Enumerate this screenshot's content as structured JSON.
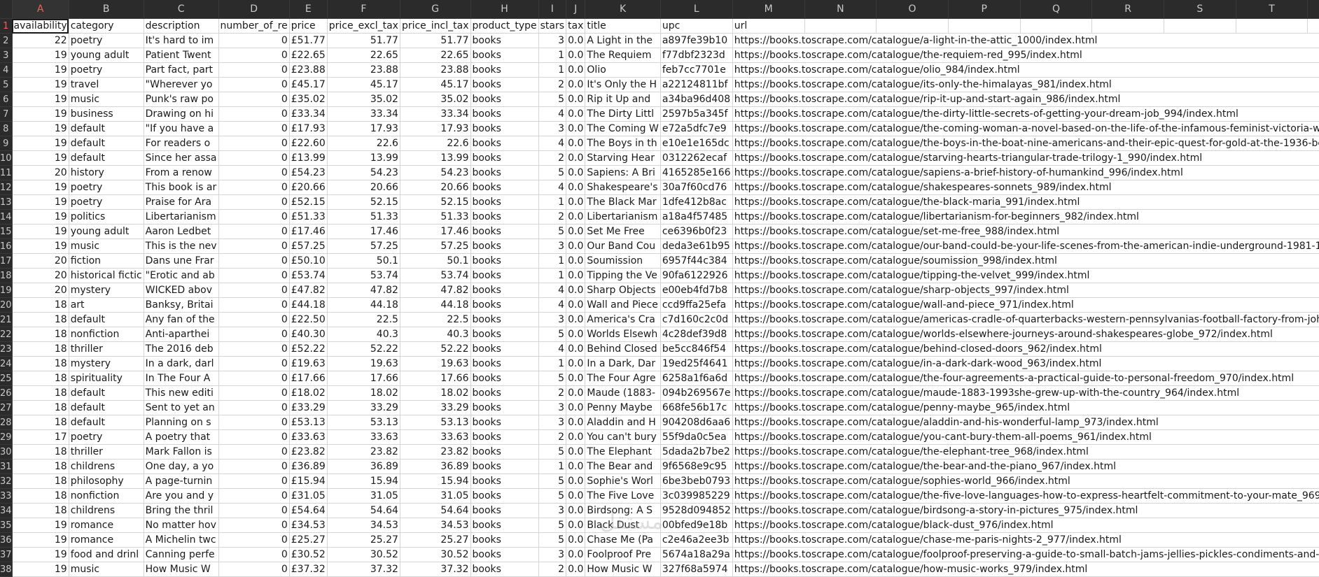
{
  "columns": [
    "A",
    "B",
    "C",
    "D",
    "E",
    "F",
    "G",
    "H",
    "I",
    "J",
    "K",
    "L",
    "M",
    "N",
    "O",
    "P",
    "Q",
    "R",
    "S",
    "T",
    ""
  ],
  "active_column": "A",
  "active_row": "1",
  "headers": [
    "availability",
    "category",
    "description",
    "number_of_re",
    "price",
    "price_excl_tax",
    "price_incl_tax",
    "product_type",
    "stars",
    "tax",
    "title",
    "upc",
    "url",
    "",
    "",
    "",
    "",
    "",
    "",
    "",
    ""
  ],
  "rows": [
    [
      "2",
      "22",
      "poetry",
      "It's hard to im",
      "0",
      "£51.77",
      "51.77",
      "51.77",
      "books",
      "3",
      "0.0",
      "A Light in the",
      "a897fe39b10",
      "https://books.toscrape.com/catalogue/a-light-in-the-attic_1000/index.html"
    ],
    [
      "3",
      "19",
      "young adult",
      "Patient Twent",
      "0",
      "£22.65",
      "22.65",
      "22.65",
      "books",
      "1",
      "0.0",
      "The Requiem",
      "f77dbf2323d",
      "https://books.toscrape.com/catalogue/the-requiem-red_995/index.html"
    ],
    [
      "4",
      "19",
      "poetry",
      "Part fact, part",
      "0",
      "£23.88",
      "23.88",
      "23.88",
      "books",
      "1",
      "0.0",
      "Olio",
      "feb7cc7701e",
      "https://books.toscrape.com/catalogue/olio_984/index.html"
    ],
    [
      "5",
      "19",
      "travel",
      "\"Wherever yo",
      "0",
      "£45.17",
      "45.17",
      "45.17",
      "books",
      "2",
      "0.0",
      "It's Only the H",
      "a22124811bf",
      "https://books.toscrape.com/catalogue/its-only-the-himalayas_981/index.html"
    ],
    [
      "6",
      "19",
      "music",
      "Punk's raw po",
      "0",
      "£35.02",
      "35.02",
      "35.02",
      "books",
      "5",
      "0.0",
      "Rip it Up and",
      "a34ba96d408",
      "https://books.toscrape.com/catalogue/rip-it-up-and-start-again_986/index.html"
    ],
    [
      "7",
      "19",
      "business",
      "Drawing on hi",
      "0",
      "£33.34",
      "33.34",
      "33.34",
      "books",
      "4",
      "0.0",
      "The Dirty Littl",
      "2597b5a345f",
      "https://books.toscrape.com/catalogue/the-dirty-little-secrets-of-getting-your-dream-job_994/index.html"
    ],
    [
      "8",
      "19",
      "default",
      "\"If you have a",
      "0",
      "£17.93",
      "17.93",
      "17.93",
      "books",
      "3",
      "0.0",
      "The Coming W",
      "e72a5dfc7e9",
      "https://books.toscrape.com/catalogue/the-coming-woman-a-novel-based-on-the-life-of-the-infamous-feminist-victoria-woo"
    ],
    [
      "9",
      "19",
      "default",
      "For readers o",
      "0",
      "£22.60",
      "22.6",
      "22.6",
      "books",
      "4",
      "0.0",
      "The Boys in th",
      "e10e1e165dc",
      "https://books.toscrape.com/catalogue/the-boys-in-the-boat-nine-americans-and-their-epic-quest-for-gold-at-the-1936-ber"
    ],
    [
      "10",
      "19",
      "default",
      "Since her assa",
      "0",
      "£13.99",
      "13.99",
      "13.99",
      "books",
      "2",
      "0.0",
      "Starving Hear",
      "0312262ecaf",
      "https://books.toscrape.com/catalogue/starving-hearts-triangular-trade-trilogy-1_990/index.html"
    ],
    [
      "11",
      "20",
      "history",
      "From a renow",
      "0",
      "£54.23",
      "54.23",
      "54.23",
      "books",
      "5",
      "0.0",
      "Sapiens: A Bri",
      "4165285e166",
      "https://books.toscrape.com/catalogue/sapiens-a-brief-history-of-humankind_996/index.html"
    ],
    [
      "12",
      "19",
      "poetry",
      "This book is ar",
      "0",
      "£20.66",
      "20.66",
      "20.66",
      "books",
      "4",
      "0.0",
      "Shakespeare's",
      "30a7f60cd76",
      "https://books.toscrape.com/catalogue/shakespeares-sonnets_989/index.html"
    ],
    [
      "13",
      "19",
      "poetry",
      "Praise for Ara",
      "0",
      "£52.15",
      "52.15",
      "52.15",
      "books",
      "1",
      "0.0",
      "The Black Mar",
      "1dfe412b8ac",
      "https://books.toscrape.com/catalogue/the-black-maria_991/index.html"
    ],
    [
      "14",
      "19",
      "politics",
      "Libertarianism",
      "0",
      "£51.33",
      "51.33",
      "51.33",
      "books",
      "2",
      "0.0",
      "Libertarianism",
      "a18a4f57485",
      "https://books.toscrape.com/catalogue/libertarianism-for-beginners_982/index.html"
    ],
    [
      "15",
      "19",
      "young adult",
      "Aaron Ledbet",
      "0",
      "£17.46",
      "17.46",
      "17.46",
      "books",
      "5",
      "0.0",
      "Set Me Free",
      "ce6396b0f23",
      "https://books.toscrape.com/catalogue/set-me-free_988/index.html"
    ],
    [
      "16",
      "19",
      "music",
      "This is the nev",
      "0",
      "£57.25",
      "57.25",
      "57.25",
      "books",
      "3",
      "0.0",
      "Our Band Cou",
      "deda3e61b95",
      "https://books.toscrape.com/catalogue/our-band-could-be-your-life-scenes-from-the-american-indie-underground-1981-19"
    ],
    [
      "17",
      "20",
      "fiction",
      "Dans une Frar",
      "0",
      "£50.10",
      "50.1",
      "50.1",
      "books",
      "1",
      "0.0",
      "Soumission",
      "6957f44c384",
      "https://books.toscrape.com/catalogue/soumission_998/index.html"
    ],
    [
      "18",
      "20",
      "historical fictic",
      "\"Erotic and ab",
      "0",
      "£53.74",
      "53.74",
      "53.74",
      "books",
      "1",
      "0.0",
      "Tipping the Ve",
      "90fa6122926",
      "https://books.toscrape.com/catalogue/tipping-the-velvet_999/index.html"
    ],
    [
      "19",
      "20",
      "mystery",
      "WICKED abov",
      "0",
      "£47.82",
      "47.82",
      "47.82",
      "books",
      "4",
      "0.0",
      "Sharp Objects",
      "e00eb4fd7b8",
      "https://books.toscrape.com/catalogue/sharp-objects_997/index.html"
    ],
    [
      "20",
      "18",
      "art",
      "Banksy, Britai",
      "0",
      "£44.18",
      "44.18",
      "44.18",
      "books",
      "4",
      "0.0",
      "Wall and Piece",
      "ccd9ffa25efa",
      "https://books.toscrape.com/catalogue/wall-and-piece_971/index.html"
    ],
    [
      "21",
      "18",
      "default",
      "Any fan of the",
      "0",
      "£22.50",
      "22.5",
      "22.5",
      "books",
      "3",
      "0.0",
      "America's Cra",
      "c7d160c2c0d",
      "https://books.toscrape.com/catalogue/americas-cradle-of-quarterbacks-western-pennsylvanias-football-factory-from-johnn"
    ],
    [
      "22",
      "18",
      "nonfiction",
      "Anti-aparthei",
      "0",
      "£40.30",
      "40.3",
      "40.3",
      "books",
      "5",
      "0.0",
      "Worlds Elsewh",
      "4c28def39d8",
      "https://books.toscrape.com/catalogue/worlds-elsewhere-journeys-around-shakespeares-globe_972/index.html"
    ],
    [
      "23",
      "18",
      "thriller",
      "The 2016 deb",
      "0",
      "£52.22",
      "52.22",
      "52.22",
      "books",
      "4",
      "0.0",
      "Behind Closed",
      "be5cc846f54",
      "https://books.toscrape.com/catalogue/behind-closed-doors_962/index.html"
    ],
    [
      "24",
      "18",
      "mystery",
      "In a dark, darl",
      "0",
      "£19.63",
      "19.63",
      "19.63",
      "books",
      "1",
      "0.0",
      "In a Dark, Dar",
      "19ed25f4641",
      "https://books.toscrape.com/catalogue/in-a-dark-dark-wood_963/index.html"
    ],
    [
      "25",
      "18",
      "spirituality",
      "In The Four A",
      "0",
      "£17.66",
      "17.66",
      "17.66",
      "books",
      "5",
      "0.0",
      "The Four Agre",
      "6258a1f6a6d",
      "https://books.toscrape.com/catalogue/the-four-agreements-a-practical-guide-to-personal-freedom_970/index.html"
    ],
    [
      "26",
      "18",
      "default",
      "This new editi",
      "0",
      "£18.02",
      "18.02",
      "18.02",
      "books",
      "2",
      "0.0",
      "Maude (1883-",
      "094b269567e",
      "https://books.toscrape.com/catalogue/maude-1883-1993she-grew-up-with-the-country_964/index.html"
    ],
    [
      "27",
      "18",
      "default",
      "Sent to yet an",
      "0",
      "£33.29",
      "33.29",
      "33.29",
      "books",
      "3",
      "0.0",
      "Penny Maybe",
      "668fe56b17c",
      "https://books.toscrape.com/catalogue/penny-maybe_965/index.html"
    ],
    [
      "28",
      "18",
      "default",
      "Planning on s",
      "0",
      "£53.13",
      "53.13",
      "53.13",
      "books",
      "3",
      "0.0",
      "Aladdin and H",
      "904208d6aa6",
      "https://books.toscrape.com/catalogue/aladdin-and-his-wonderful-lamp_973/index.html"
    ],
    [
      "29",
      "17",
      "poetry",
      "A poetry that",
      "0",
      "£33.63",
      "33.63",
      "33.63",
      "books",
      "2",
      "0.0",
      "You can't bury",
      "55f9da0c5ea",
      "https://books.toscrape.com/catalogue/you-cant-bury-them-all-poems_961/index.html"
    ],
    [
      "30",
      "18",
      "thriller",
      "Mark Fallon is",
      "0",
      "£23.82",
      "23.82",
      "23.82",
      "books",
      "5",
      "0.0",
      "The Elephant",
      "5dada2b7be2",
      "https://books.toscrape.com/catalogue/the-elephant-tree_968/index.html"
    ],
    [
      "31",
      "18",
      "childrens",
      "One day, a yo",
      "0",
      "£36.89",
      "36.89",
      "36.89",
      "books",
      "1",
      "0.0",
      "The Bear and",
      "9f6568e9c95",
      "https://books.toscrape.com/catalogue/the-bear-and-the-piano_967/index.html"
    ],
    [
      "32",
      "18",
      "philosophy",
      "A page-turnin",
      "0",
      "£15.94",
      "15.94",
      "15.94",
      "books",
      "5",
      "0.0",
      "Sophie's Worl",
      "6be3beb0793",
      "https://books.toscrape.com/catalogue/sophies-world_966/index.html"
    ],
    [
      "33",
      "18",
      "nonfiction",
      "Are you and y",
      "0",
      "£31.05",
      "31.05",
      "31.05",
      "books",
      "5",
      "0.0",
      "The Five Love",
      "3c039985229",
      "https://books.toscrape.com/catalogue/the-five-love-languages-how-to-express-heartfelt-commitment-to-your-mate_969/i"
    ],
    [
      "34",
      "18",
      "childrens",
      "Bring the thril",
      "0",
      "£54.64",
      "54.64",
      "54.64",
      "books",
      "3",
      "0.0",
      "Birdsong: A S",
      "9528d094852",
      "https://books.toscrape.com/catalogue/birdsong-a-story-in-pictures_975/index.html"
    ],
    [
      "35",
      "19",
      "romance",
      "No matter hov",
      "0",
      "£34.53",
      "34.53",
      "34.53",
      "books",
      "5",
      "0.0",
      "Black Dust",
      "00bfed9e18b",
      "https://books.toscrape.com/catalogue/black-dust_976/index.html"
    ],
    [
      "36",
      "19",
      "romance",
      "A Michelin twc",
      "0",
      "£25.27",
      "25.27",
      "25.27",
      "books",
      "5",
      "0.0",
      "Chase Me (Pa",
      "c2e46a2ee3b",
      "https://books.toscrape.com/catalogue/chase-me-paris-nights-2_977/index.html"
    ],
    [
      "37",
      "19",
      "food and drinl",
      "Canning perfe",
      "0",
      "£30.52",
      "30.52",
      "30.52",
      "books",
      "3",
      "0.0",
      "Foolproof Pre",
      "5674a18a29a",
      "https://books.toscrape.com/catalogue/foolproof-preserving-a-guide-to-small-batch-jams-jellies-pickles-condiments-and-mo"
    ],
    [
      "38",
      "19",
      "music",
      "How Music W",
      "0",
      "£37.32",
      "37.32",
      "37.32",
      "books",
      "2",
      "0.0",
      "How Music W",
      "327f68a5974",
      "https://books.toscrape.com/catalogue/how-music-works_979/index.html"
    ]
  ]
}
